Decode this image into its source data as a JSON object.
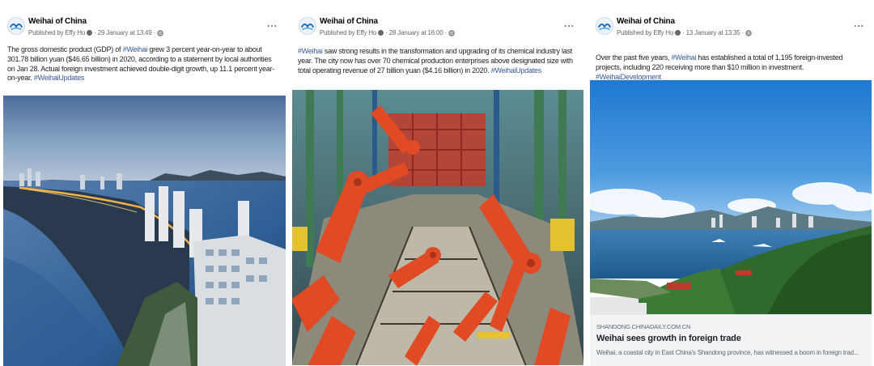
{
  "posts": [
    {
      "page_name": "Weihai of China",
      "published_by": "Published by Effy Ho",
      "date": "29 January at 13:49",
      "more": "...",
      "text_1": "The gross domestic product (GDP) of ",
      "hashtag_1": "#Weihai",
      "text_2": " grew 3 percent year-on-year to about 301.78 billion yuan ($46.65 billion) in 2020, according to a statement by local authorities on Jan 28. Actual foreign investment achieved double-digit growth, up 11.1 percent year-on-year. ",
      "hashtag_2": "#WeihaiUpdates",
      "image": "weihai-coastal-city-at-dusk"
    },
    {
      "page_name": "Weihai of China",
      "published_by": "Published by Effy Ho",
      "date": "28 January at 16:00",
      "more": "...",
      "hashtag_1": "#Weihai",
      "text_1": " saw strong results in the transformation and upgrading of its chemical industry last year. The city now has over 70 chemical production enterprises above designated size with total operating revenue of 27 billion yuan ($4.16 billion) in 2020. ",
      "hashtag_2": "#WeihaiUpdates",
      "image": "robotic-assembly-line"
    },
    {
      "page_name": "Weihai of China",
      "published_by": "Published by Effy Ho",
      "date": "13 January at 13:35",
      "more": "...",
      "text_1": "Over the past five years, ",
      "hashtag_1": "#Weihai",
      "text_2": " has established a total of 1,195 foreign-invested projects, including 220 receiving more than $10 million in investment. ",
      "hashtag_2": "#WeihaiDevelopment",
      "image": "weihai-bay-panorama",
      "link": {
        "domain": "SHANDONG.CHINADAILY.COM.CN",
        "title": "Weihai sees growth in foreign trade",
        "description": "Weihai, a coastal city in East China's Shandong province, has witnessed a boom in foreign trad..."
      }
    }
  ],
  "colors": {
    "hashtag": "#385898",
    "meta": "#65676b",
    "name": "#050505"
  },
  "icons": [
    "page-avatar-logo",
    "verified-dot-icon",
    "globe-icon",
    "more-icon"
  ]
}
